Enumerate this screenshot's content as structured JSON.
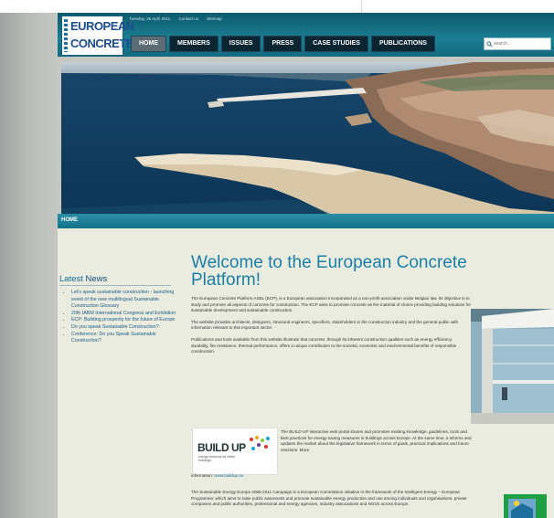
{
  "logo": {
    "line1": "EUROPEAN",
    "line2": "CONCRETE"
  },
  "dateline": [
    "Tuesday, 26 April 2011",
    "Contact us",
    "Sitemap"
  ],
  "nav": [
    {
      "label": "HOME",
      "active": true
    },
    {
      "label": "MEMBERS",
      "active": false
    },
    {
      "label": "ISSUES",
      "active": false
    },
    {
      "label": "PRESS",
      "active": false
    },
    {
      "label": "CASE STUDIES",
      "active": false
    },
    {
      "label": "PUBLICATIONS",
      "active": false
    }
  ],
  "search": {
    "placeholder": "search...",
    "icon": "search-icon"
  },
  "breadcrumb": "HOME",
  "sidebar": {
    "title_part1": "Latest",
    "title_part2": "News",
    "news": [
      "Let's speak sustainable construction - launching event of the new multilingual Sustainable Construction Glossary",
      "20th IABM International Congress and Exhibition",
      "ECP: Building prosperity for the future of Europe",
      "Do you speak Sustainable Construction?",
      "Conference: Do you Speak Sustainable Construction?"
    ]
  },
  "main": {
    "title": "Welcome to the European Concrete Platform!",
    "p1": "The European Concrete Platform ASBL (ECP), is a European association incorporated as a non-profit association under Belgian law. Its objective is to study and promote all aspects of concrete for construction. The ECP aims to promote concrete as the material of choice providing building solutions for sustainable development and sustainable construction.",
    "p2": "The website provides architects, designers, structural engineers, specifiers, stakeholders in the construction industry and the general public with information relevant to this important sector.",
    "p3": "Publications and tools available from this website illustrate that concrete, through its inherent construction qualities such as energy efficiency, durability, fire resistance, thermal performance, offers a unique contribution to the societal, economic and environmental benefits of responsible construction.",
    "buildup_logo_title": "BUILD UP",
    "buildup_logo_sub": "energy solutions for better buildings",
    "buildup_text": "The BUILD UP interactive web portal shares and promotes existing knowledge, guidelines, tools and best practices for energy-saving measures in buildings across Europe. At the same time, it informs and updates the market about the legislative framework in terms of goals, practical implications and future revisions. More",
    "info_label": "information:",
    "info_link": "www.buildup.eu",
    "p4": "The Sustainable Energy Europe 2005-2011 Campaign is a European Commission initiative in the framework of the Intelligent Energy – European Programme, which aims to raise public awareness and promote sustainable energy production and use among individuals and organisations, private companies and public authorities, professional and energy agencies, industry associations and NGOs across Europe."
  },
  "colors": {
    "header": "#1b7e93",
    "nav_item": "#0b2533",
    "accent": "#1b7fa7",
    "content_bg": "#e9ecdf",
    "page_bg": "#c5c7c3"
  }
}
